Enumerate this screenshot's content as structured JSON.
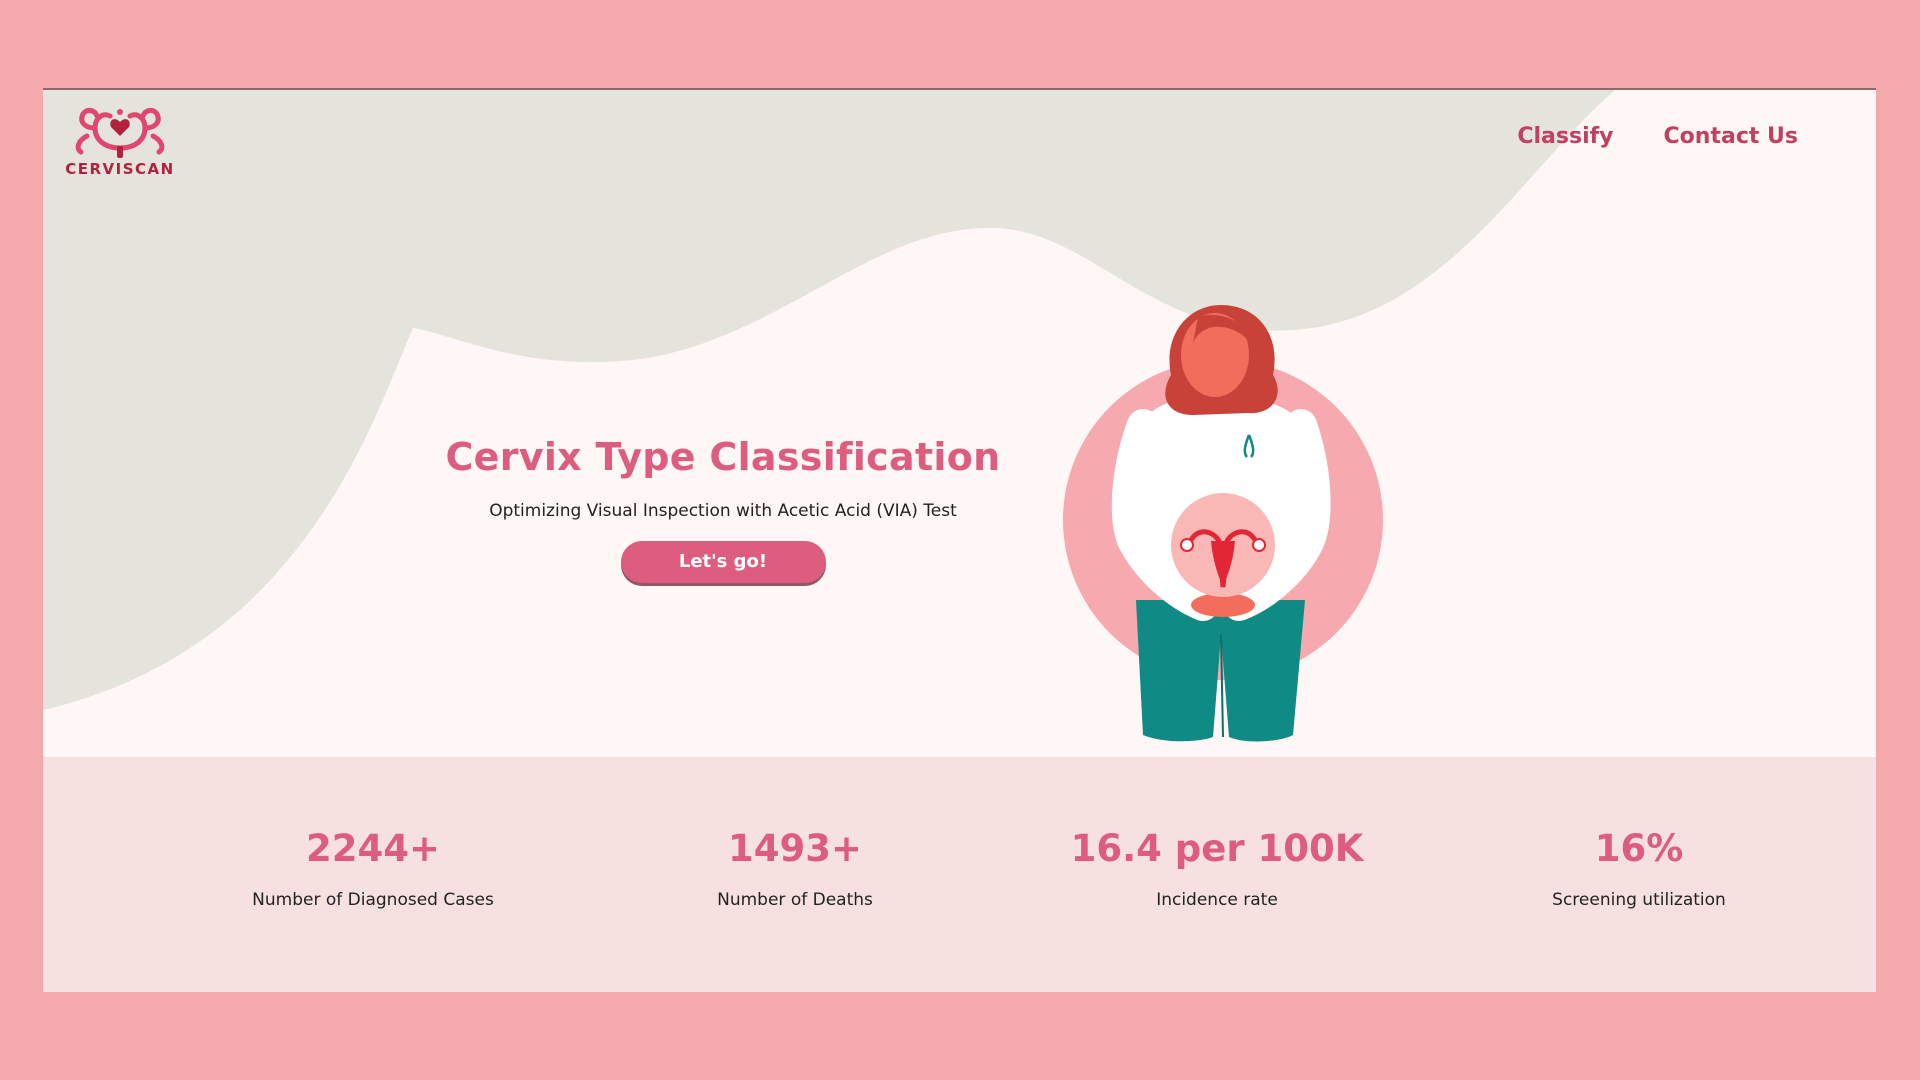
{
  "brand": {
    "name": "CERVISCAN",
    "logo_icon": "uterus-flower-logo"
  },
  "nav": {
    "items": [
      {
        "label": "Classify"
      },
      {
        "label": "Contact Us"
      }
    ]
  },
  "hero": {
    "title": "Cervix Type Classification",
    "subtitle": "Optimizing Visual Inspection with Acetic Acid (VIA) Test",
    "cta_label": "Let's go!",
    "illustration": "woman-holding-uterus-illustration"
  },
  "stats": [
    {
      "value": "2244+",
      "label": "Number of Diagnosed Cases"
    },
    {
      "value": "1493+",
      "label": "Number of Deaths"
    },
    {
      "value": "16.4 per 100K",
      "label": "Incidence rate"
    },
    {
      "value": "16%",
      "label": "Screening utilization"
    }
  ],
  "colors": {
    "outer_background": "#f4a9ad",
    "page_background": "#fef7f6",
    "blob": "#e5e4dc",
    "accent": "#dc5d7e",
    "nav_text": "#c2405f",
    "stats_background": "#f6e1e0"
  }
}
